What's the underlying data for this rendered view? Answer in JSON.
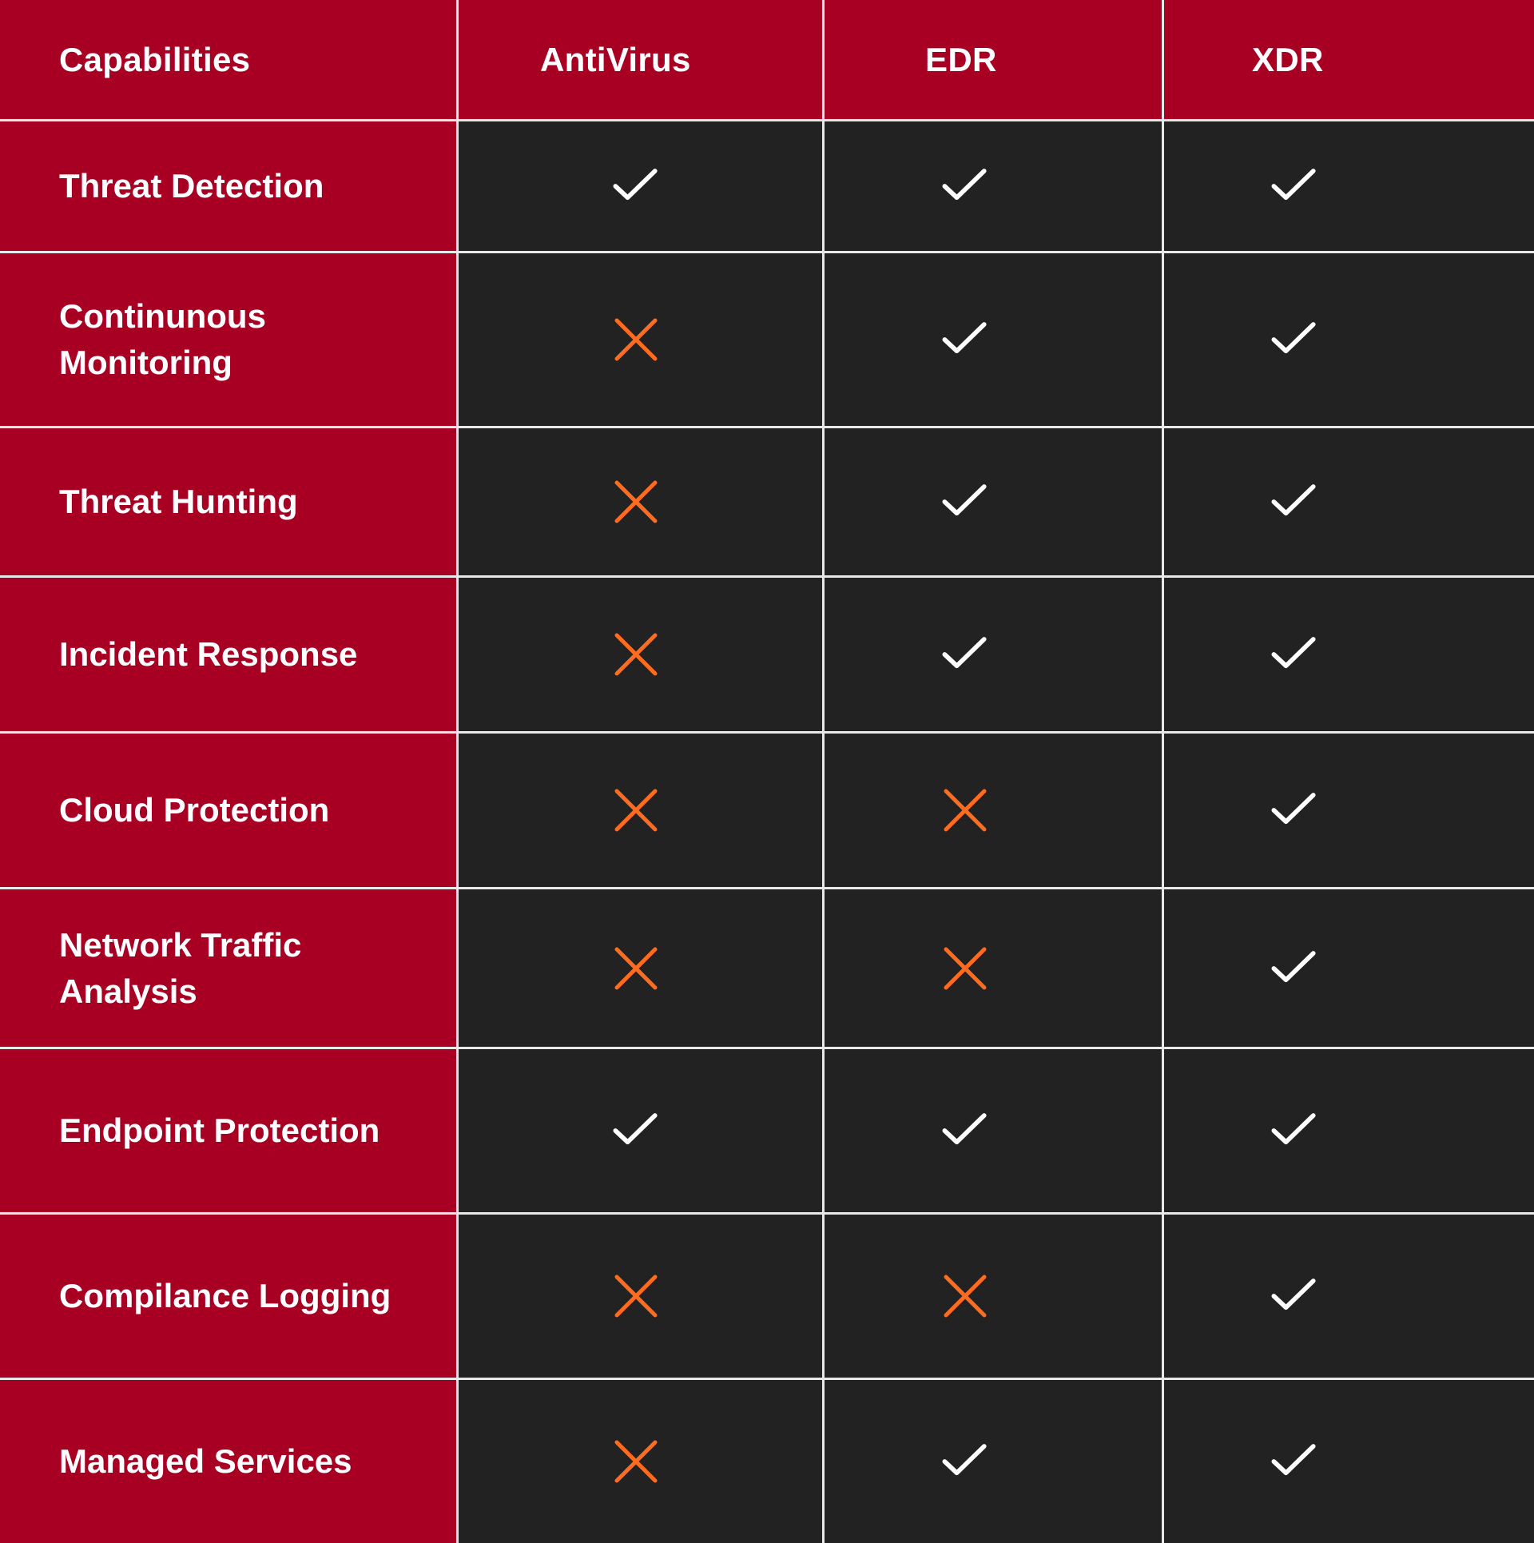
{
  "colors": {
    "header_bg": "#a80023",
    "label_bg": "#a80023",
    "cell_bg": "#222222",
    "grid_line": "#e9e9e9",
    "check": "#ffffff",
    "cross": "#ff6b1f"
  },
  "header": {
    "capabilities": "Capabilities",
    "columns": [
      "AntiVirus",
      "EDR",
      "XDR"
    ]
  },
  "rows": [
    {
      "label": "Threat Detection",
      "values": [
        "check-icon",
        "check-icon",
        "check-icon"
      ]
    },
    {
      "label": "Continunous Monitoring",
      "values": [
        "cross-icon",
        "check-icon",
        "check-icon"
      ]
    },
    {
      "label": "Threat Hunting",
      "values": [
        "cross-icon",
        "check-icon",
        "check-icon"
      ]
    },
    {
      "label": "Incident Response",
      "values": [
        "cross-icon",
        "check-icon",
        "check-icon"
      ]
    },
    {
      "label": "Cloud Protection",
      "values": [
        "cross-icon",
        "cross-icon",
        "check-icon"
      ]
    },
    {
      "label": "Network Traffic Analysis",
      "values": [
        "cross-icon",
        "cross-icon",
        "check-icon"
      ]
    },
    {
      "label": "Endpoint Protection",
      "values": [
        "check-icon",
        "check-icon",
        "check-icon"
      ]
    },
    {
      "label": "Compilance Logging",
      "values": [
        "cross-icon",
        "cross-icon",
        "check-icon"
      ]
    },
    {
      "label": "Managed Services",
      "values": [
        "cross-icon",
        "check-icon",
        "check-icon"
      ]
    }
  ]
}
